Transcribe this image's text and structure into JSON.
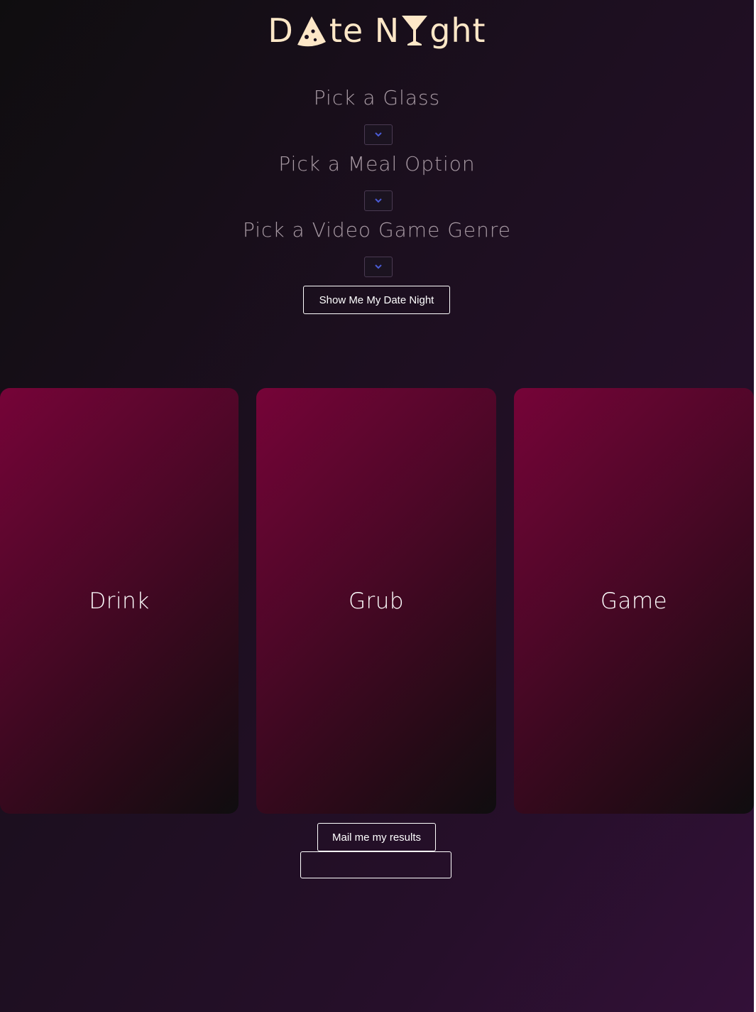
{
  "logo": {
    "part1": "D",
    "part2": "te N",
    "part3": "ght",
    "pizza_icon": "pizza-slice-icon",
    "cocktail_icon": "cocktail-glass-icon",
    "color": "#fde7c7"
  },
  "form": {
    "glass_label": "Pick a Glass",
    "meal_label": "Pick a Meal Option",
    "genre_label": "Pick a Video Game Genre",
    "select_icon": "chevron-down-icon",
    "submit_label": "Show Me My Date Night"
  },
  "cards": [
    {
      "label": "Drink"
    },
    {
      "label": "Grub"
    },
    {
      "label": "Game"
    }
  ],
  "mail": {
    "button_label": "Mail me my results",
    "input_value": ""
  },
  "colors": {
    "card_start": "#760438",
    "card_end": "#0f0d0f",
    "background_start": "#0f0d0f",
    "background_end": "#331038",
    "label_color": "#a89aa4",
    "chevron_color": "#4a5bd4"
  }
}
